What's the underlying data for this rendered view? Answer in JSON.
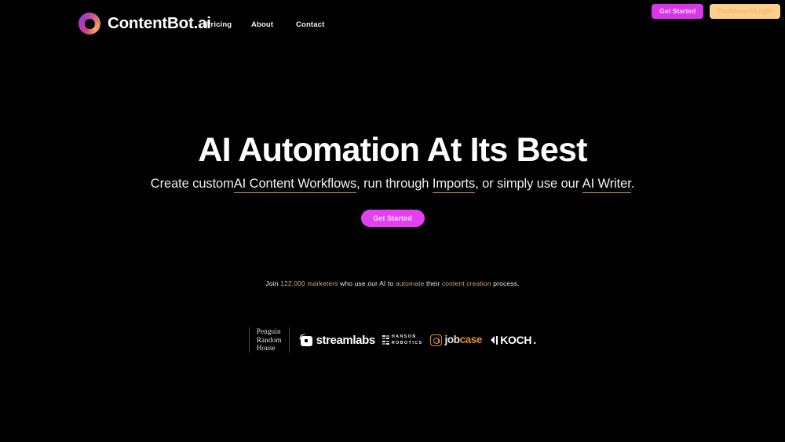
{
  "site": {
    "background_color": "#000000",
    "accent_magenta": "#d936e8",
    "accent_tan": "#d4a574",
    "accent_peach": "#fcd08a"
  },
  "header": {
    "brand_name": "ContentBot.ai",
    "logo_icon": "gradient-ring-icon",
    "nav": [
      {
        "label": "Pricing"
      },
      {
        "label": "About"
      },
      {
        "label": "Contact"
      }
    ],
    "get_started_label": "Get Started",
    "dashboard_login_label": "Dashboard Login"
  },
  "hero": {
    "title": "AI Automation At Its Best",
    "subtitle": {
      "part1": "Create custom",
      "link1": "AI Content Workflows",
      "part2": ", run through ",
      "link2": "Imports",
      "part3": ", or simply use our ",
      "link3": "AI Writer",
      "part4": "."
    },
    "cta_label": "Get Started"
  },
  "social_proof": {
    "prefix": "Join ",
    "count": "122,000 marketers",
    "middle": " who use our AI to ",
    "accent1": "automate",
    "middle2": " their ",
    "accent2": "content creation",
    "suffix": " process."
  },
  "logo_strip": {
    "penguin_random_house": {
      "line1": "Penguin",
      "line2": "Random",
      "line3": "House"
    },
    "streamlabs": {
      "name": "streamlabs",
      "icon": "streamlabs-mark-icon"
    },
    "hanson_robotics": {
      "line1": "HANSON",
      "line2": "ROBOTICS",
      "icon": "hanson-bars-icon"
    },
    "jobcase": {
      "part1": "job",
      "part2": "case",
      "icon": "jobcase-at-icon"
    },
    "koch": {
      "name": "KOCH",
      "dot": ".",
      "icon": "koch-bars-icon"
    }
  }
}
